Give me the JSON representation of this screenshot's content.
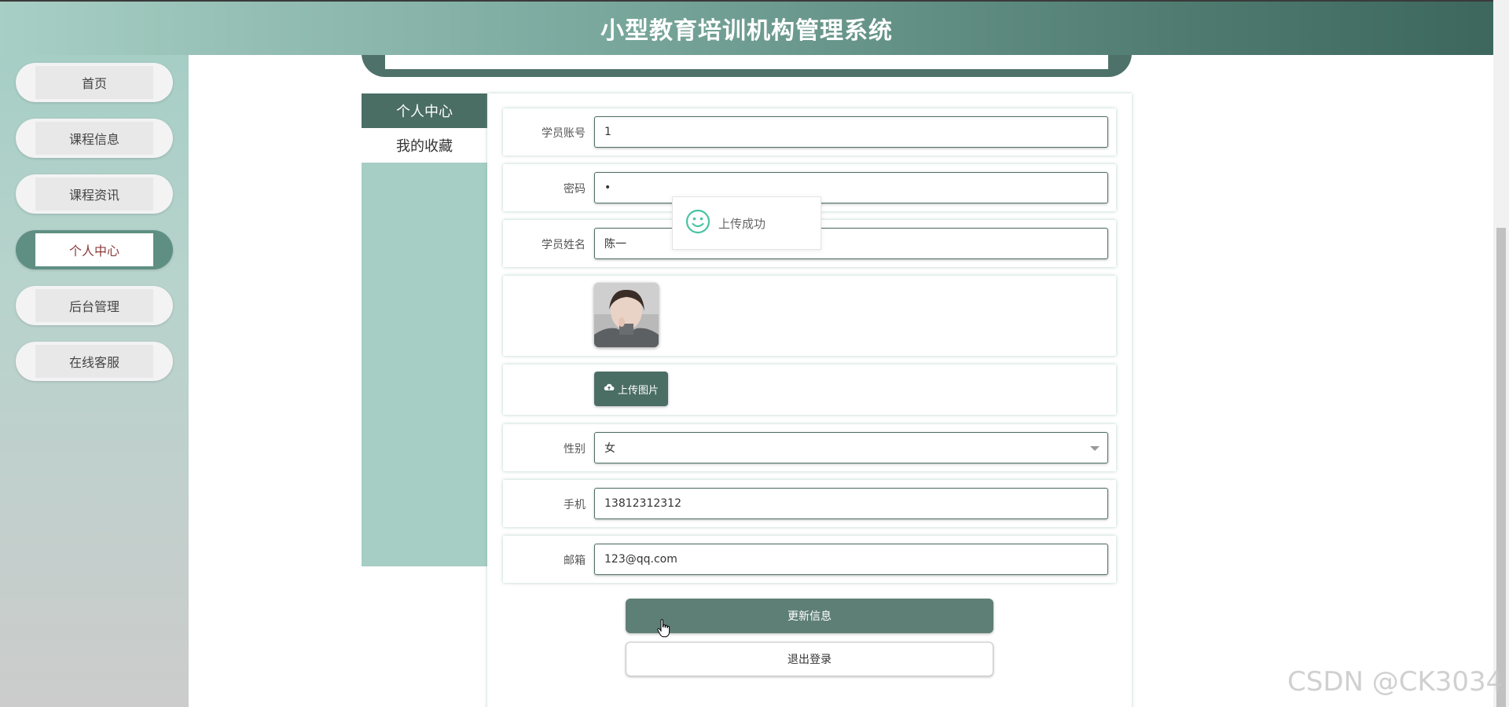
{
  "header": {
    "title": "小型教育培训机构管理系统"
  },
  "sidebar": {
    "items": [
      {
        "label": "首页"
      },
      {
        "label": "课程信息"
      },
      {
        "label": "课程资讯"
      },
      {
        "label": "个人中心",
        "active": true
      },
      {
        "label": "后台管理"
      },
      {
        "label": "在线客服"
      }
    ]
  },
  "center_menu": {
    "items": [
      {
        "label": "个人中心",
        "active": true
      },
      {
        "label": "我的收藏"
      }
    ]
  },
  "form": {
    "account_label": "学员账号",
    "account_value": "1",
    "password_label": "密码",
    "password_value": "•",
    "name_label": "学员姓名",
    "name_value": "陈一",
    "upload_label": "上传图片",
    "gender_label": "性别",
    "gender_value": "女",
    "phone_label": "手机",
    "phone_value": "13812312312",
    "email_label": "邮箱",
    "email_value": "123@qq.com"
  },
  "actions": {
    "update_label": "更新信息",
    "logout_label": "退出登录"
  },
  "toast": {
    "message": "上传成功",
    "icon": "smile-icon"
  },
  "watermark": "CSDN @CK3034",
  "colors": {
    "primary": "#4a6d64",
    "accent": "#a6cec5",
    "active_text": "#8a3b3b"
  }
}
